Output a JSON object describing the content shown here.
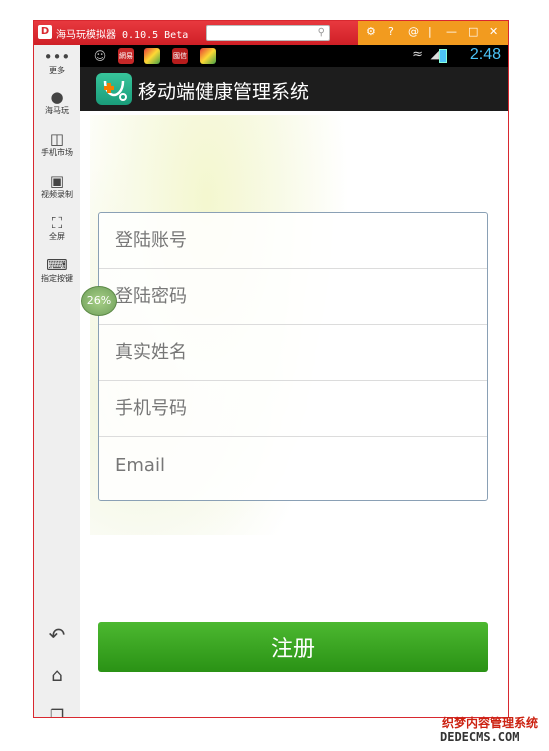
{
  "emulator": {
    "title": "海马玩模拟器 0.10.5 Beta",
    "toolbar_icons": [
      "settings-icon",
      "help-icon",
      "at-icon",
      "minimize-icon",
      "maximize-icon",
      "close-icon"
    ]
  },
  "sidebar": {
    "more": "更多",
    "items": [
      {
        "label": "海马玩",
        "icon": "haima-icon"
      },
      {
        "label": "手机市场",
        "icon": "market-icon"
      },
      {
        "label": "视频录制",
        "icon": "video-record-icon"
      },
      {
        "label": "全屏",
        "icon": "fullscreen-icon"
      },
      {
        "label": "指定按键",
        "icon": "keymap-icon"
      }
    ],
    "progress_badge": "26%"
  },
  "status_bar": {
    "notifications": [
      "網易",
      "國信"
    ],
    "time": "2:48"
  },
  "app": {
    "title": "移动端健康管理系统",
    "form": {
      "account_placeholder": "登陆账号",
      "password_placeholder": "登陆密码",
      "realname_placeholder": "真实姓名",
      "phone_placeholder": "手机号码",
      "email_placeholder": "Email"
    },
    "register_label": "注册"
  },
  "watermark": {
    "line1": "织梦内容管理系统",
    "line2": "DEDECMS.COM"
  }
}
